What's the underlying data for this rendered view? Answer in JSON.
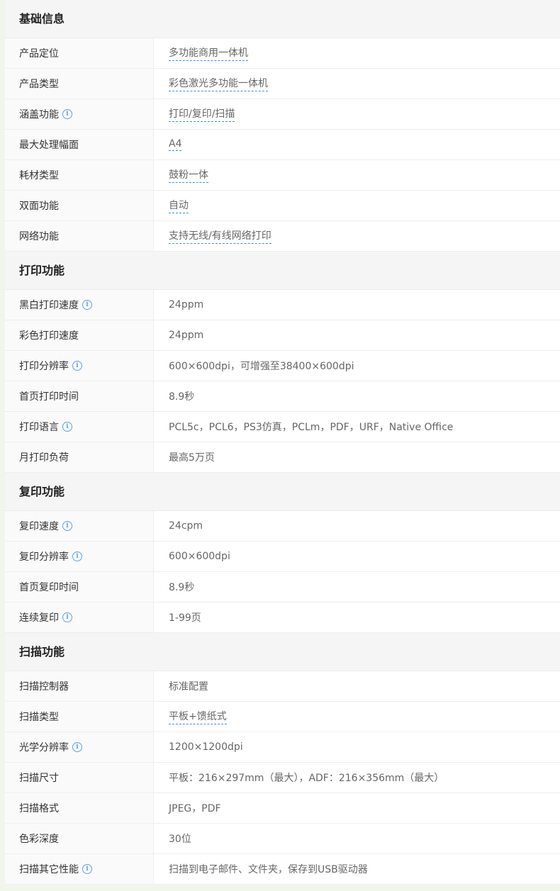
{
  "sections": [
    {
      "title": "基础信息",
      "rows": [
        {
          "label": "产品定位",
          "value": "多功能商用一体机",
          "info": false,
          "link": true
        },
        {
          "label": "产品类型",
          "value": "彩色激光多功能一体机",
          "info": false,
          "link": true
        },
        {
          "label": "涵盖功能",
          "value": "打印/复印/扫描",
          "info": true,
          "link": true
        },
        {
          "label": "最大处理幅面",
          "value": "A4",
          "info": false,
          "link": true
        },
        {
          "label": "耗材类型",
          "value": "鼓粉一体",
          "info": false,
          "link": true
        },
        {
          "label": "双面功能",
          "value": "自动",
          "info": false,
          "link": true
        },
        {
          "label": "网络功能",
          "value": "支持无线/有线网络打印",
          "info": false,
          "link": true
        }
      ]
    },
    {
      "title": "打印功能",
      "rows": [
        {
          "label": "黑白打印速度",
          "value": "24ppm",
          "info": true,
          "link": false
        },
        {
          "label": "彩色打印速度",
          "value": "24ppm",
          "info": false,
          "link": false
        },
        {
          "label": "打印分辨率",
          "value": "600×600dpi，可增强至38400×600dpi",
          "info": true,
          "link": false
        },
        {
          "label": "首页打印时间",
          "value": "8.9秒",
          "info": false,
          "link": false
        },
        {
          "label": "打印语言",
          "value": "PCL5c，PCL6，PS3仿真，PCLm，PDF，URF，Native Office",
          "info": true,
          "link": false
        },
        {
          "label": "月打印负荷",
          "value": "最高5万页",
          "info": false,
          "link": false
        }
      ]
    },
    {
      "title": "复印功能",
      "rows": [
        {
          "label": "复印速度",
          "value": "24cpm",
          "info": true,
          "link": false
        },
        {
          "label": "复印分辨率",
          "value": "600×600dpi",
          "info": true,
          "link": false
        },
        {
          "label": "首页复印时间",
          "value": "8.9秒",
          "info": false,
          "link": false
        },
        {
          "label": "连续复印",
          "value": "1-99页",
          "info": true,
          "link": false
        }
      ]
    },
    {
      "title": "扫描功能",
      "rows": [
        {
          "label": "扫描控制器",
          "value": "标准配置",
          "info": false,
          "link": false
        },
        {
          "label": "扫描类型",
          "value": "平板+馈纸式",
          "info": false,
          "link": true
        },
        {
          "label": "光学分辨率",
          "value": "1200×1200dpi",
          "info": true,
          "link": false
        },
        {
          "label": "扫描尺寸",
          "value": "平板：216×297mm（最大），ADF：216×356mm（最大）",
          "info": false,
          "link": false
        },
        {
          "label": "扫描格式",
          "value": "JPEG，PDF",
          "info": false,
          "link": false
        },
        {
          "label": "色彩深度",
          "value": "30位",
          "info": false,
          "link": false
        },
        {
          "label": "扫描其它性能",
          "value": "扫描到电子邮件、文件夹，保存到USB驱动器",
          "info": true,
          "link": false
        }
      ]
    }
  ],
  "info_icon_glyph": "i",
  "colors": {
    "link_underline": "#3a8ee6",
    "info_icon": "#5aa3e8",
    "page_bg": "#f1f6ec"
  }
}
